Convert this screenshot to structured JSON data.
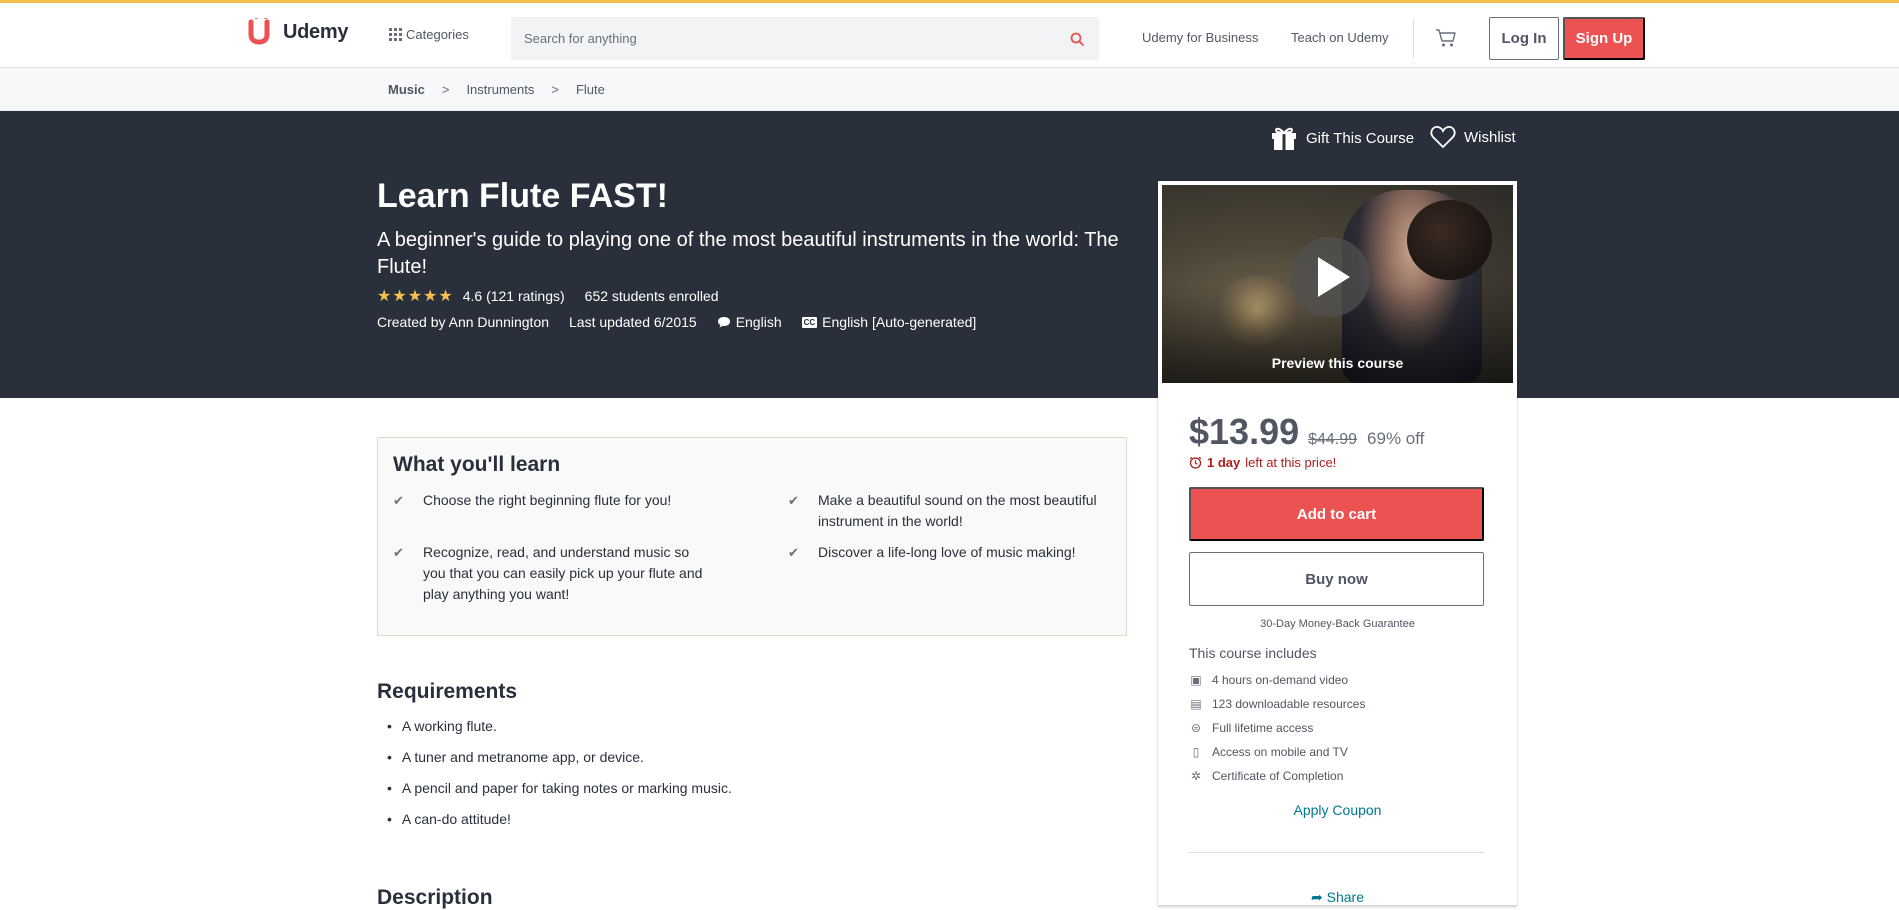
{
  "header": {
    "logo_text": "Udemy",
    "categories_label": "Categories",
    "search_placeholder": "Search for anything",
    "business_link": "Udemy for Business",
    "teach_link": "Teach on Udemy",
    "login_label": "Log In",
    "signup_label": "Sign Up"
  },
  "breadcrumb": [
    "Music",
    "Instruments",
    "Flute"
  ],
  "breadcrumb_sep": ">",
  "hero": {
    "gift_label": "Gift This Course",
    "wishlist_label": "Wishlist",
    "title": "Learn Flute FAST!",
    "subtitle": "A beginner's guide to playing one of the most beautiful instruments in the world: The Flute!",
    "stars": "★★★★★",
    "rating_text": "4.6 (121 ratings)",
    "enrolled_text": "652 students enrolled",
    "created_by": "Created by Ann Dunnington",
    "last_updated": "Last updated 6/2015",
    "language": "English",
    "cc_badge": "CC",
    "captions": "English [Auto-generated]"
  },
  "sidebar": {
    "preview_label": "Preview this course",
    "price": "$13.99",
    "original_price": "$44.99",
    "discount": "69% off",
    "timer_bold": "1 day",
    "timer_rest": "left at this price!",
    "add_to_cart": "Add to cart",
    "buy_now": "Buy now",
    "guarantee": "30-Day Money-Back Guarantee",
    "includes_title": "This course includes",
    "includes": [
      {
        "icon": "video-icon",
        "text": "4 hours on-demand video"
      },
      {
        "icon": "file-icon",
        "text": "123 downloadable resources"
      },
      {
        "icon": "infinity-icon",
        "text": "Full lifetime access"
      },
      {
        "icon": "mobile-icon",
        "text": "Access on mobile and TV"
      },
      {
        "icon": "certificate-icon",
        "text": "Certificate of Completion"
      }
    ],
    "apply_coupon": "Apply Coupon",
    "share": "Share"
  },
  "learn": {
    "title": "What you'll learn",
    "items": [
      "Choose the right beginning flute for you!",
      "Make a beautiful sound on the most beautiful instrument in the world!",
      "Recognize, read, and understand music so you that you can easily pick up your flute and play anything you want!",
      "Discover a life-long love of music making!"
    ]
  },
  "requirements": {
    "title": "Requirements",
    "items": [
      "A working flute.",
      "A tuner and metranome app, or device.",
      "A pencil and paper for taking notes or marking music.",
      "A can-do attitude!"
    ]
  },
  "description": {
    "title": "Description"
  },
  "colors": {
    "brand_red": "#ec5252",
    "hero_bg": "#29303b",
    "star": "#f4c150",
    "link": "#007791",
    "topline": "#f4c150"
  }
}
